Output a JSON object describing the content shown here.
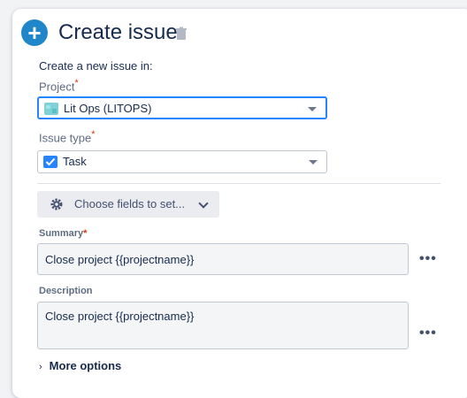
{
  "header": {
    "title": "Create issue",
    "icon": "plus-circle-icon",
    "delete_icon": "trash-icon"
  },
  "intro_text": "Create a new issue in:",
  "project": {
    "label": "Project",
    "required_mark": "*",
    "selected": "Lit Ops (LITOPS)",
    "icon": "project-avatar-icon"
  },
  "issue_type": {
    "label": "Issue type",
    "required_mark": "*",
    "selected": "Task",
    "icon": "task-checkbox-icon"
  },
  "choose_fields": {
    "label": "Choose fields to set...",
    "icon": "gear-icon"
  },
  "summary": {
    "label": "Summary",
    "required_mark": "*",
    "value": "Close project {{projectname}}",
    "more": "•••"
  },
  "description": {
    "label": "Description",
    "value": "Close project {{projectname}}",
    "more": "•••"
  },
  "more_options": {
    "caret": "›",
    "label": "More options"
  },
  "colors": {
    "accent": "#1f86c9",
    "focus_border": "#2684ff",
    "required": "#de350b",
    "task_blue": "#2684ff",
    "project_avatar": "#7fd1d8"
  }
}
